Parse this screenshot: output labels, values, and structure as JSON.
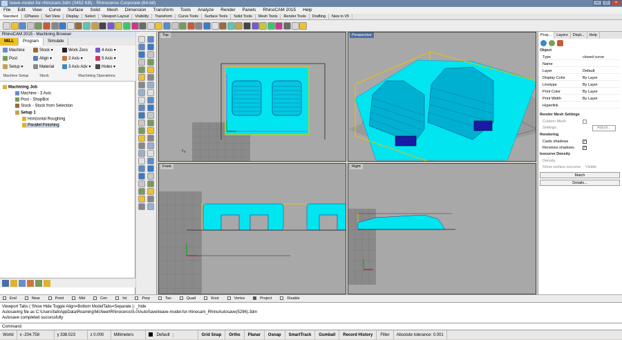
{
  "window": {
    "title": "leave-model-for-rhinocam.3dm (3452 KB) - Rhinoceros Corporate (64-bit)"
  },
  "menu": [
    "File",
    "Edit",
    "View",
    "Curve",
    "Surface",
    "Solid",
    "Mesh",
    "Dimension",
    "Transform",
    "Tools",
    "Analyze",
    "Render",
    "Panels",
    "RhinoCAM 2015",
    "Help"
  ],
  "toolbar_tabs": [
    "Standard",
    "CPlanes",
    "Set View",
    "Display",
    "Select",
    "Viewport Layout",
    "Visibility",
    "Transform",
    "Curve Tools",
    "Surface Tools",
    "Solid Tools",
    "Mesh Tools",
    "Render Tools",
    "Drafting",
    "New in V5"
  ],
  "left_panel": {
    "title": "RhinoCAM 2015 - Machining Browser",
    "tabs": [
      "MILL",
      "Program",
      "Simulate"
    ],
    "ribbon": {
      "machine": "Machine",
      "post": "Post",
      "setup": "Setup",
      "stock": "Stock",
      "align": "Align",
      "material": "Material",
      "work_zero": "Work Zero",
      "axis2": "2 Axis",
      "axis3adv": "3 Axis Adv",
      "axis4": "4 Axis",
      "axis5": "5 Axis",
      "holes": "Holes",
      "groups": [
        "Machine Setup",
        "Stock",
        "Machining Operations"
      ]
    },
    "tree": [
      "Machining Job",
      "Machine - 3 Axis",
      "Post - ShopBot",
      "Stock - Stock from Selection",
      "Setup 1",
      "Horizontal Roughing",
      "Parallel Finishing"
    ]
  },
  "viewports": {
    "top": "Top",
    "perspective": "Perspective",
    "front": "Front",
    "right": "Right"
  },
  "right_panel": {
    "tabs": [
      "Prop...",
      "Layers",
      "Displ...",
      "Help"
    ],
    "section_object": "Object",
    "rows": [
      {
        "k": "Type",
        "v": "closed curve"
      },
      {
        "k": "Name",
        "v": ""
      },
      {
        "k": "Layer",
        "v": "Default"
      },
      {
        "k": "Display Color",
        "v": "By Layer"
      },
      {
        "k": "Linetype",
        "v": "By Layer"
      },
      {
        "k": "Print Color",
        "v": "By Layer"
      },
      {
        "k": "Print Width",
        "v": "By Layer"
      },
      {
        "k": "Hyperlink",
        "v": ""
      }
    ],
    "render_mesh": "Render Mesh Settings",
    "custom_mesh": "Custom Mesh",
    "settings": "Settings",
    "adjust": "Adjust...",
    "rendering": "Rendering",
    "casts": "Casts shadows",
    "receives": "Receives shadows",
    "isocurve": "Isocurve Density",
    "density": "Density",
    "show_iso": "Show surface isocurve",
    "visible": "Visible",
    "match": "Match",
    "details": "Details..."
  },
  "osnaps": [
    "End",
    "Near",
    "Point",
    "Mid",
    "Cen",
    "Int",
    "Perp",
    "Tan",
    "Quad",
    "Knot",
    "Vertex",
    "Project",
    "Disable"
  ],
  "command_history": [
    "Viewport Tabs ( Show  Hide  Toggle  Align=Bottom  ModelTabs=Separate ): _hide",
    "Autosaving file as C:\\Users\\fab\\AppData\\Roaming\\McNeel\\Rhinoceros\\5.0\\AutoSave\\leave-model-for-rhinocam_RhinoAutosave(5296).3dm",
    "Autosave completed successfully"
  ],
  "command_prompt": "Command:",
  "status": {
    "cplane": "World",
    "x": "x -204.758",
    "y": "y 338.023",
    "z": "z 0.000",
    "units": "Millimeters",
    "layer": "Default",
    "toggles": [
      "Grid Snap",
      "Ortho",
      "Planar",
      "Osnap",
      "SmartTrack",
      "Gumball",
      "Record History",
      "Filter"
    ],
    "tolerance": "Absolute tolerance: 0.001"
  }
}
